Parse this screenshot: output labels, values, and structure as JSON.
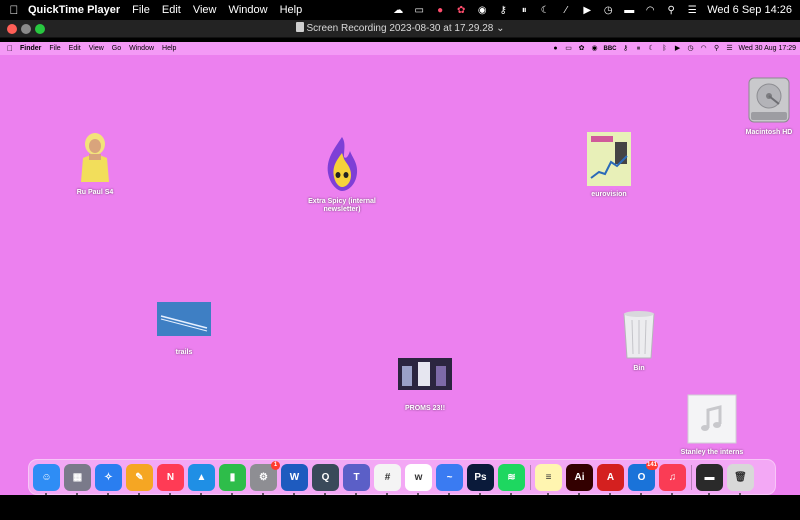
{
  "outer_menubar": {
    "app_name": "QuickTime Player",
    "menus": [
      "File",
      "Edit",
      "View",
      "Window",
      "Help"
    ],
    "datetime": "Wed 6 Sep  14:26",
    "status_icons": [
      "creative-cloud-icon",
      "display-icon",
      "record-stop-icon",
      "paw-icon",
      "eye-icon",
      "key-icon",
      "pause-icon",
      "moon-icon",
      "slash-icon",
      "play-icon",
      "clock-icon",
      "battery-icon",
      "wifi-icon",
      "search-icon",
      "control-center-icon",
      "siri-icon"
    ]
  },
  "window": {
    "title": "Screen Recording 2023-08-30 at 17.29.28 ⌄"
  },
  "inner_menubar": {
    "app_name": "Finder",
    "menus": [
      "File",
      "Edit",
      "View",
      "Go",
      "Window",
      "Help"
    ],
    "bbc_label": "BBC",
    "datetime": "Wed 30 Aug  17:29"
  },
  "desktop_icons": {
    "macintosh_hd": "Macintosh HD",
    "rupaul": "Ru Paul S4",
    "extra_spicy": "Extra Spicy (internal newsletter)",
    "eurovision": "eurovision",
    "trails": "trails",
    "bin": "Bin",
    "proms": "PROMS 23!!",
    "stanley": "Stanley the interns"
  },
  "dock": {
    "apps": [
      {
        "name": "Finder",
        "color": "#2e8df5",
        "glyph": "☺"
      },
      {
        "name": "Launchpad",
        "color": "#7a7a8a",
        "glyph": "▦"
      },
      {
        "name": "Safari",
        "color": "#2a7ef0",
        "glyph": "✧"
      },
      {
        "name": "Pages",
        "color": "#f5a623",
        "glyph": "✎"
      },
      {
        "name": "News",
        "color": "#ff3b55",
        "glyph": "N"
      },
      {
        "name": "Keynote",
        "color": "#1f8fe5",
        "glyph": "▲"
      },
      {
        "name": "Numbers",
        "color": "#2ebd4a",
        "glyph": "▮"
      },
      {
        "name": "System Settings",
        "color": "#8e8e93",
        "glyph": "⚙"
      },
      {
        "name": "Word",
        "color": "#1e5bbf",
        "glyph": "W"
      },
      {
        "name": "QuickTime",
        "color": "#3a4a5a",
        "glyph": "Q"
      },
      {
        "name": "Teams",
        "color": "#5b5fc7",
        "glyph": "T"
      },
      {
        "name": "Slack",
        "color": "#f4f4f4",
        "glyph": "#"
      },
      {
        "name": "Webex",
        "color": "#ffffff",
        "glyph": "w"
      },
      {
        "name": "Freeform",
        "color": "#3a7bf2",
        "glyph": "~"
      },
      {
        "name": "Photoshop",
        "color": "#0a1a3a",
        "glyph": "Ps"
      },
      {
        "name": "Spotify",
        "color": "#1ed760",
        "glyph": "≋"
      },
      {
        "name": "Notes",
        "color": "#fff5b0",
        "glyph": "≡"
      },
      {
        "name": "Illustrator",
        "color": "#330000",
        "glyph": "Ai"
      },
      {
        "name": "Acrobat",
        "color": "#d4201f",
        "glyph": "A"
      },
      {
        "name": "Outlook",
        "color": "#1a73d9",
        "glyph": "O"
      },
      {
        "name": "Music",
        "color": "#fa3c55",
        "glyph": "♫"
      },
      {
        "name": "Downloads",
        "color": "#2a2a2a",
        "glyph": "▬"
      },
      {
        "name": "Trash",
        "color": "#d8d8d8",
        "glyph": "🗑"
      }
    ],
    "badges": {
      "system_settings": "1",
      "outlook": "141"
    }
  }
}
